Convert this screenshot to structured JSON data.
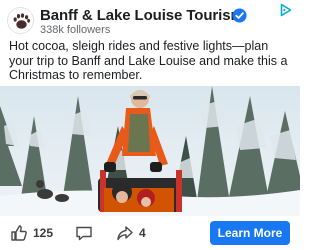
{
  "page": {
    "name": "Banff & Lake Louise Tourism",
    "followers": "338k followers"
  },
  "post": {
    "message": "Hot cocoa, sleigh rides and festive lights—plan your trip to Banff and Lake Louise and make this a Christmas to remember."
  },
  "actions": {
    "like_count": "125",
    "share_count": "4",
    "cta_label": "Learn More"
  },
  "colors": {
    "brand_blue": "#1778f2",
    "verified_blue": "#1877f2",
    "adchoices_cyan": "#00aecd"
  },
  "icons": {
    "verified": "verified-badge-icon",
    "adchoices": "adchoices-icon",
    "like": "thumbs-up-icon",
    "comment": "comment-icon",
    "share": "share-arrow-icon"
  }
}
